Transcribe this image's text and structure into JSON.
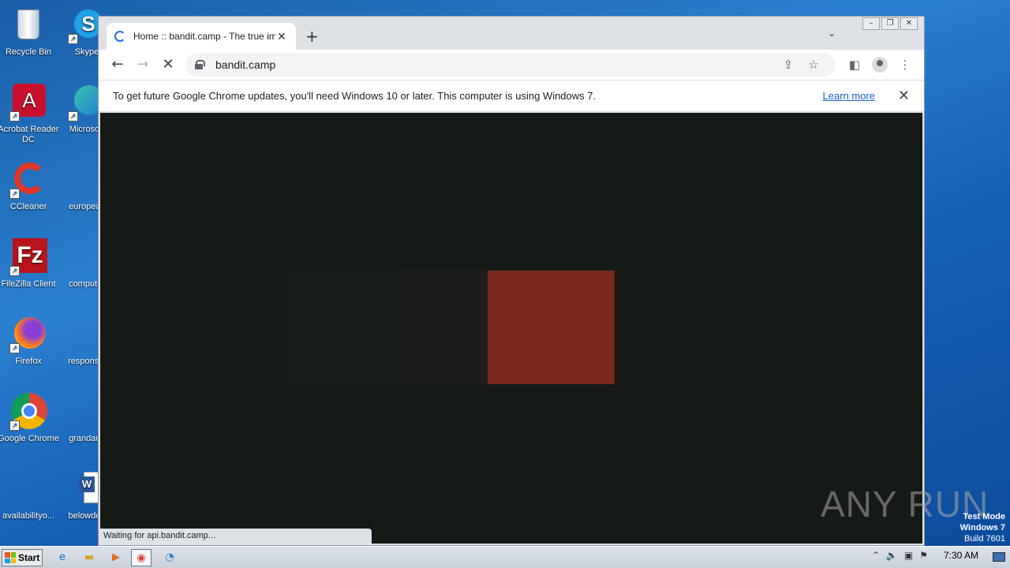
{
  "desktop": {
    "icons": [
      {
        "label": "Recycle Bin",
        "icon": "recycle-bin-icon"
      },
      {
        "label": "Skype",
        "icon": "skype-icon"
      },
      {
        "label": "Acrobat Reader DC",
        "icon": "acrobat-icon"
      },
      {
        "label": "Microsoft",
        "icon": "edge-icon"
      },
      {
        "label": "CCleaner",
        "icon": "ccleaner-icon"
      },
      {
        "label": "europeac",
        "icon": "document-icon"
      },
      {
        "label": "FileZilla Client",
        "icon": "filezilla-icon"
      },
      {
        "label": "computer",
        "icon": "document-icon"
      },
      {
        "label": "Firefox",
        "icon": "firefox-icon"
      },
      {
        "label": "responsib",
        "icon": "document-icon"
      },
      {
        "label": "Google Chrome",
        "icon": "chrome-icon"
      },
      {
        "label": "grandaus",
        "icon": "document-icon"
      },
      {
        "label": "availabilityo...",
        "icon": "document-icon"
      },
      {
        "label": "belowdea",
        "icon": "word-icon"
      }
    ]
  },
  "browser": {
    "tab_title": "Home :: bandit.camp - The true imme",
    "url": "bandit.camp",
    "infobar": {
      "message": "To get future Google Chrome updates, you'll need Windows 10 or later. This computer is using Windows 7.",
      "link": "Learn more"
    },
    "status": "Waiting for api.bandit.camp...",
    "colors": {
      "content_bg": "#161a16",
      "accent_block": "#7d291d"
    }
  },
  "watermark": "ANY RUN",
  "testmode": {
    "line1": "Test Mode",
    "line2": "Windows 7",
    "line3": "Build 7601"
  },
  "taskbar": {
    "start_label": "Start",
    "clock": "7:30 AM"
  }
}
